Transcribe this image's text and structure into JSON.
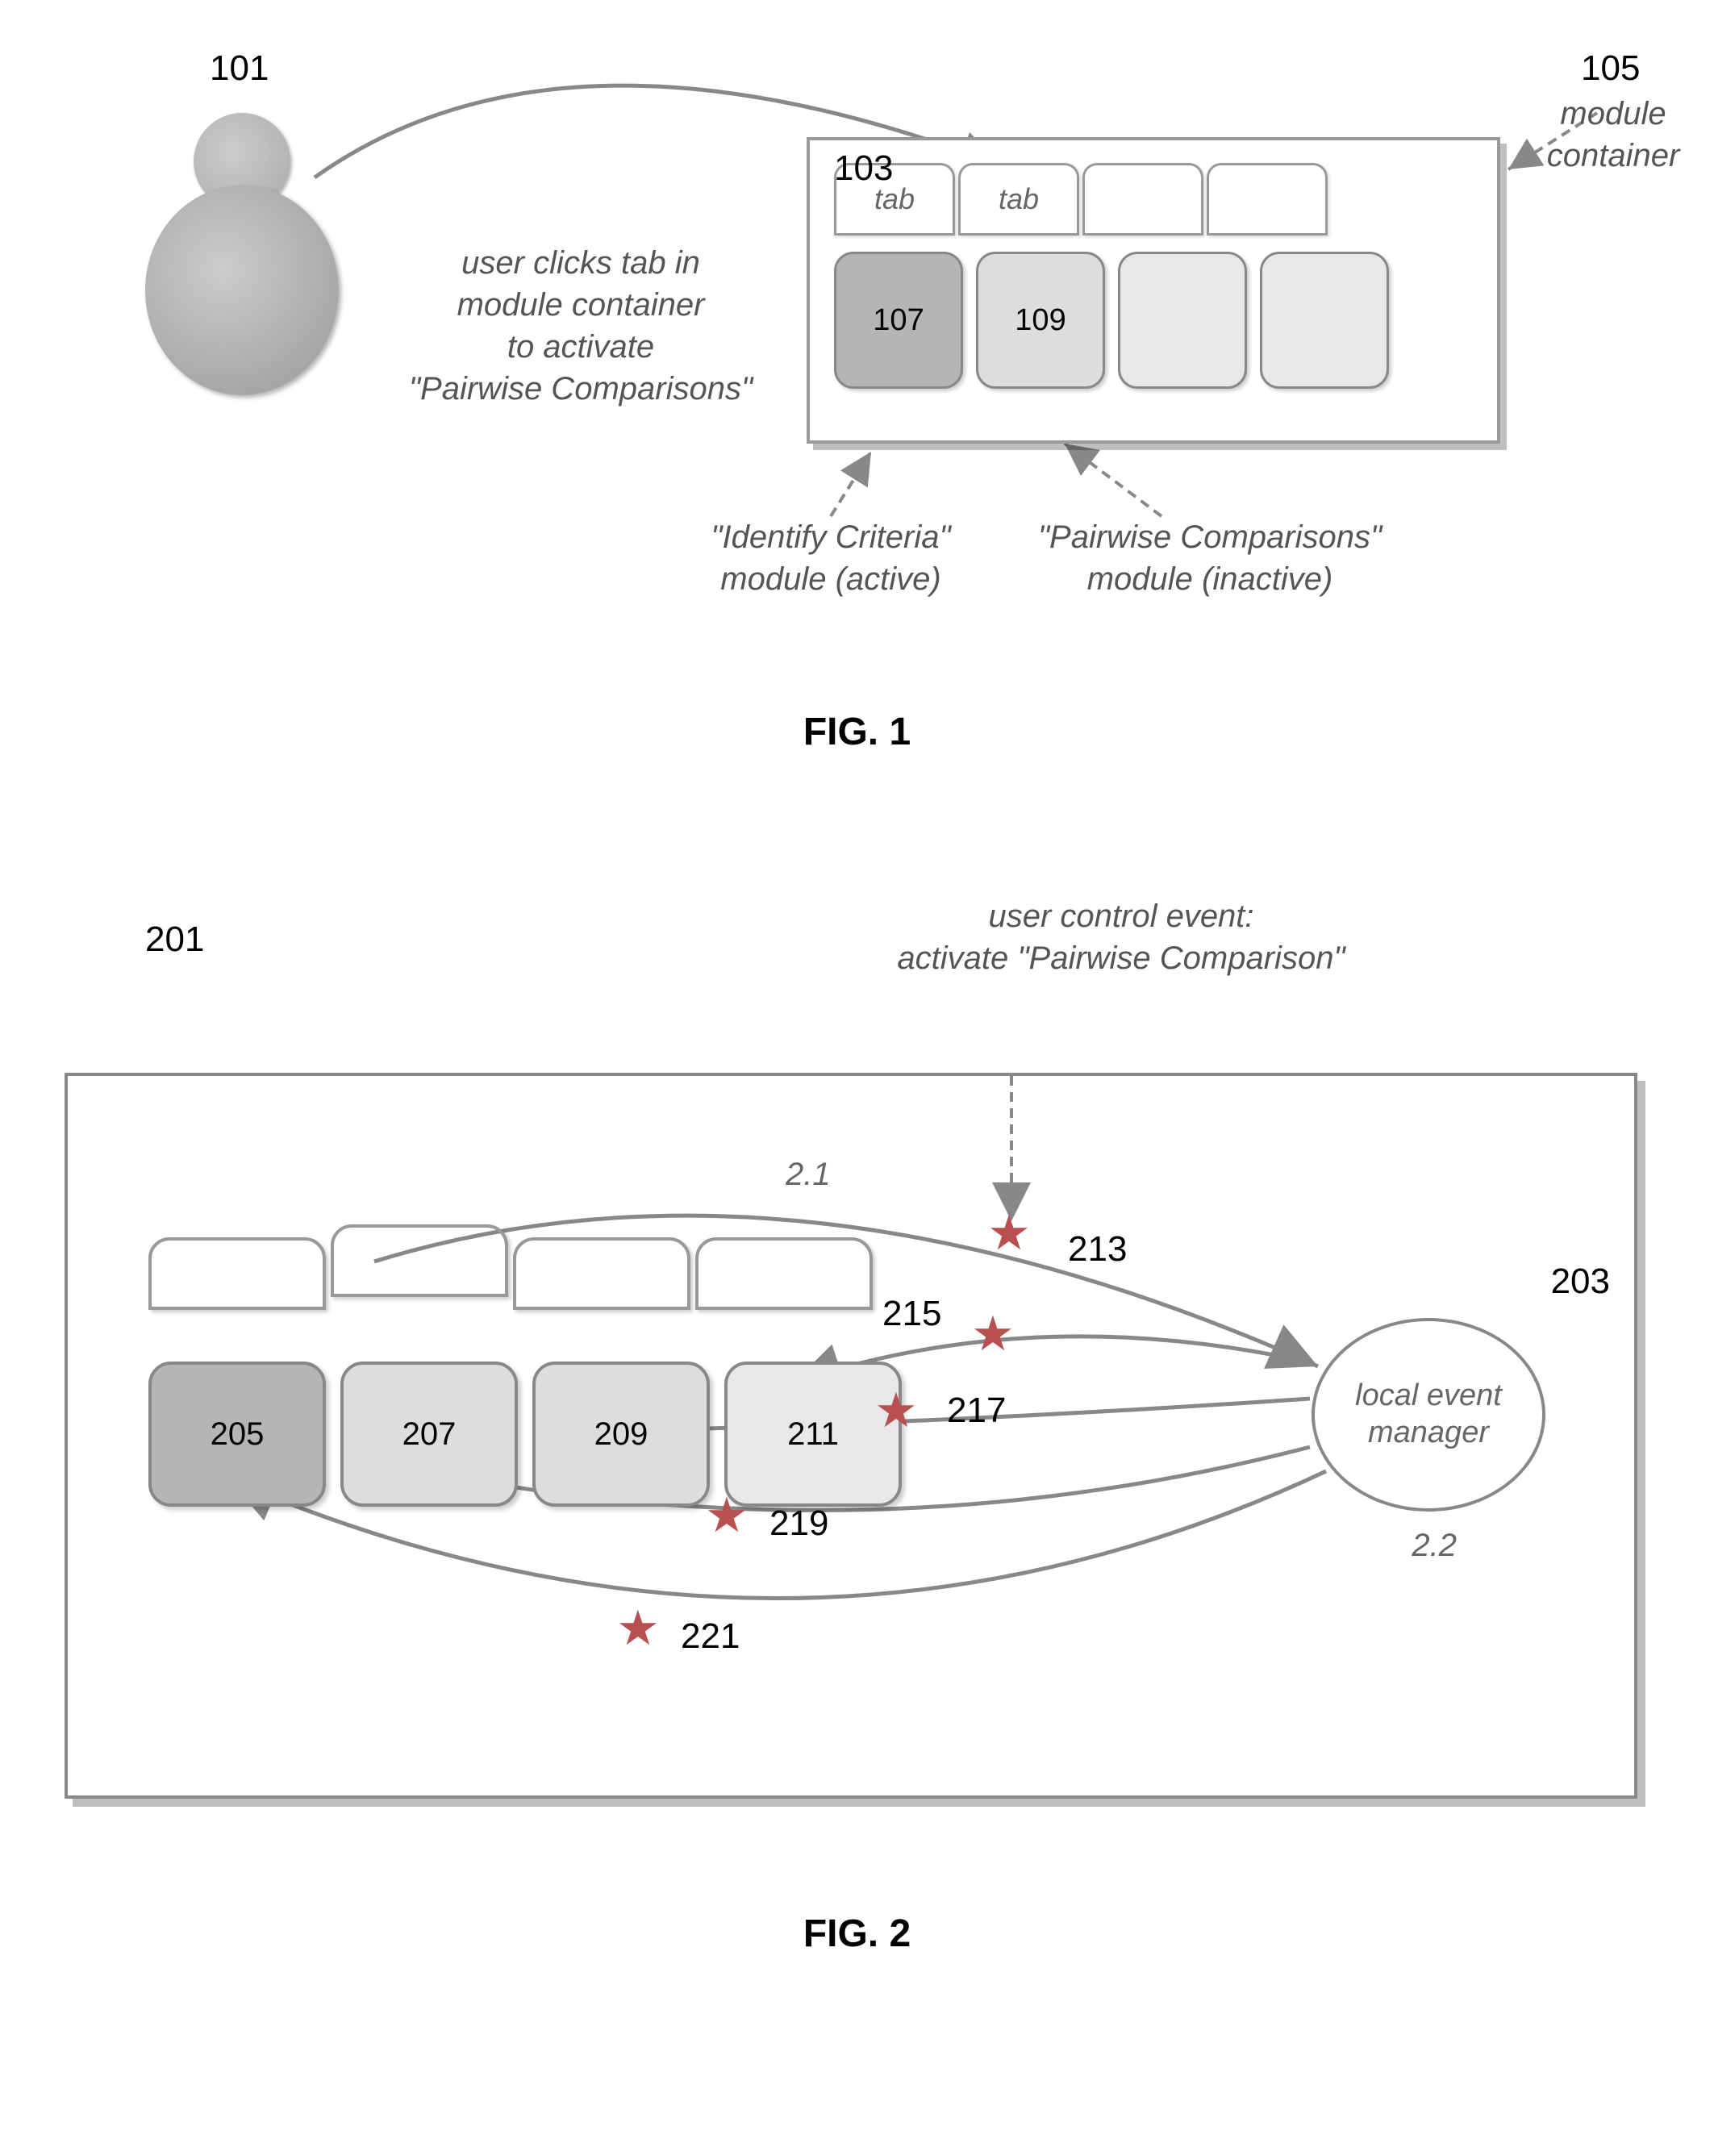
{
  "fig1": {
    "label": "FIG. 1",
    "refs": {
      "user": "101",
      "tab": "103",
      "container": "105",
      "modActive": "107",
      "modInactive": "109"
    },
    "clickNote": "user clicks tab in\nmodule container\nto activate\n\"Pairwise Comparisons\"",
    "containerLabel": "module\ncontainer",
    "activeLabel": "\"Identify Criteria\"\nmodule (active)",
    "inactiveLabel": "\"Pairwise Comparisons\"\nmodule (inactive)",
    "tabText": "tab"
  },
  "fig2": {
    "label": "FIG. 2",
    "refs": {
      "container": "201",
      "eventMgr": "203",
      "m1": "205",
      "m2": "207",
      "m3": "209",
      "m4": "211",
      "e1": "213",
      "e2": "215",
      "e3": "217",
      "e4": "219",
      "e5": "221"
    },
    "eventNote": "user control event:\nactivate \"Pairwise Comparison\"",
    "eventMgrLabel": "local event\nmanager",
    "step1": "2.1",
    "step2": "2.2"
  }
}
